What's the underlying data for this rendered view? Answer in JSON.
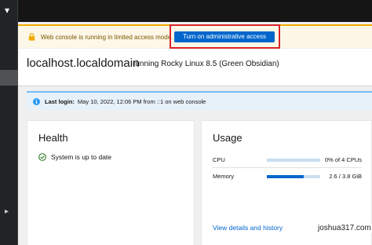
{
  "banner": {
    "message": "Web console is running in limited access mode.",
    "button_label": "Turn on administrative access",
    "icon": "lock-icon",
    "accent_color": "#f0ab00",
    "button_color": "#0066cc",
    "highlight_color": "#d9252b"
  },
  "host": {
    "hostname": "localhost.localdomain",
    "os_text": "running Rocky Linux 8.5 (Green Obsidian)"
  },
  "last_login": {
    "label": "Last login:",
    "value": "May 10, 2022, 12:06 PM from ::1 on web console",
    "icon": "info-icon"
  },
  "health": {
    "title": "Health",
    "status_text": "System is up to date",
    "status_icon": "check-circle-icon",
    "status_color": "#3e8635"
  },
  "usage": {
    "title": "Usage",
    "rows": [
      {
        "name": "CPU",
        "value": "0% of 4 CPUs",
        "fraction": 0.0
      },
      {
        "name": "Memory",
        "value": "2.6 / 3.8 GiB",
        "fraction": 0.684
      }
    ],
    "details_link": "View details and history"
  },
  "watermark": "joshua317.com"
}
